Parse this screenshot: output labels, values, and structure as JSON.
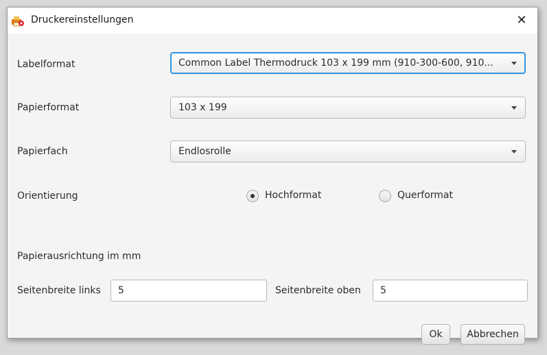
{
  "window": {
    "title": "Druckereinstellungen",
    "close_glyph": "✕",
    "icon": "printer-settings-icon"
  },
  "labelformat": {
    "label": "Labelformat",
    "value": "Common Label Thermodruck 103 x 199 mm (910-300-600, 910..."
  },
  "papierformat": {
    "label": "Papierformat",
    "value": "103 x 199"
  },
  "papierfach": {
    "label": "Papierfach",
    "value": "Endlosrolle"
  },
  "orientierung": {
    "label": "Orientierung",
    "options": [
      {
        "label": "Hochformat",
        "selected": true
      },
      {
        "label": "Querformat",
        "selected": false
      }
    ]
  },
  "alignment": {
    "heading": "Papierausrichtung im mm",
    "left_label": "Seitenbreite links",
    "left_value": "5",
    "top_label": "Seitenbreite oben",
    "top_value": "5"
  },
  "buttons": {
    "ok": "Ok",
    "cancel": "Abbrechen"
  },
  "colors": {
    "accent": "#2f94e0",
    "dialog_bg": "#f4f4f4",
    "titlebar_bg": "#ffffff"
  }
}
